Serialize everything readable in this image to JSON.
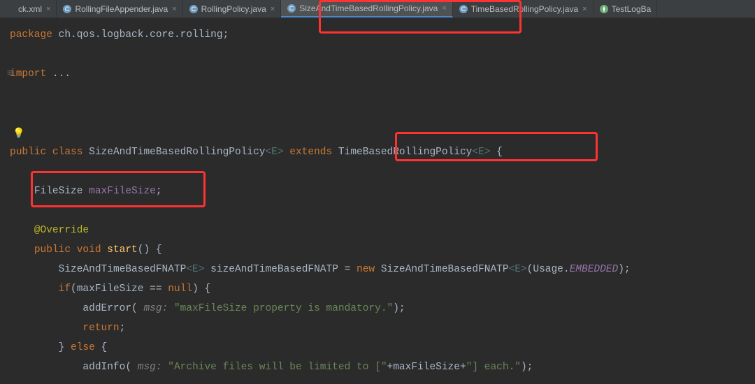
{
  "tabs": [
    {
      "label": "ck.xml",
      "icon": "xml",
      "active": false
    },
    {
      "label": "RollingFileAppender.java",
      "icon": "java",
      "active": false
    },
    {
      "label": "RollingPolicy.java",
      "icon": "java",
      "active": false
    },
    {
      "label": "SizeAndTimeBasedRollingPolicy.java",
      "icon": "java",
      "active": true
    },
    {
      "label": "TimeBasedRollingPolicy.java",
      "icon": "java",
      "active": false
    },
    {
      "label": "TestLogBa",
      "icon": "test",
      "active": false,
      "noClose": true
    }
  ],
  "code": {
    "pkg_kw": "package",
    "pkg_name": " ch.qos.logback.core.rolling",
    "import_kw": "import",
    "import_ellipsis": " ...",
    "public_kw": "public",
    "class_kw": "class",
    "class_name": " SizeAndTimeBasedRollingPolicy",
    "gen_e": "<E>",
    "extends_kw": " extends ",
    "super_name": "TimeBasedRollingPolicy",
    "open_brace": " {",
    "field_type": "FileSize ",
    "field_name": "maxFileSize",
    "semi": ";",
    "override": "@Override",
    "void_kw": "void",
    "start_name": " start",
    "start_sig": "() {",
    "fnatp_type": "SizeAndTimeBasedFNATP",
    "var_name": " sizeAndTimeBasedFNATP = ",
    "new_kw": "new ",
    "usage": "(Usage.",
    "embedded": "EMBEDDED",
    "close_paren_semi": ");",
    "if_kw": "if",
    "cond": "(maxFileSize == ",
    "null_kw": "null",
    "cond_close": ") {",
    "addError": "addError(",
    "msg_hint": " msg: ",
    "err_str": "\"maxFileSize property is mandatory.\"",
    "close_call": ");",
    "return_kw": "return",
    "else_line": "} ",
    "else_kw": "else",
    "else_brace": " {",
    "addInfo": "addInfo(",
    "info_str1": "\"Archive files will be limited to [\"",
    "plus": "+",
    "info_str2": "\"] each.\"",
    "close_bracket": "}"
  }
}
